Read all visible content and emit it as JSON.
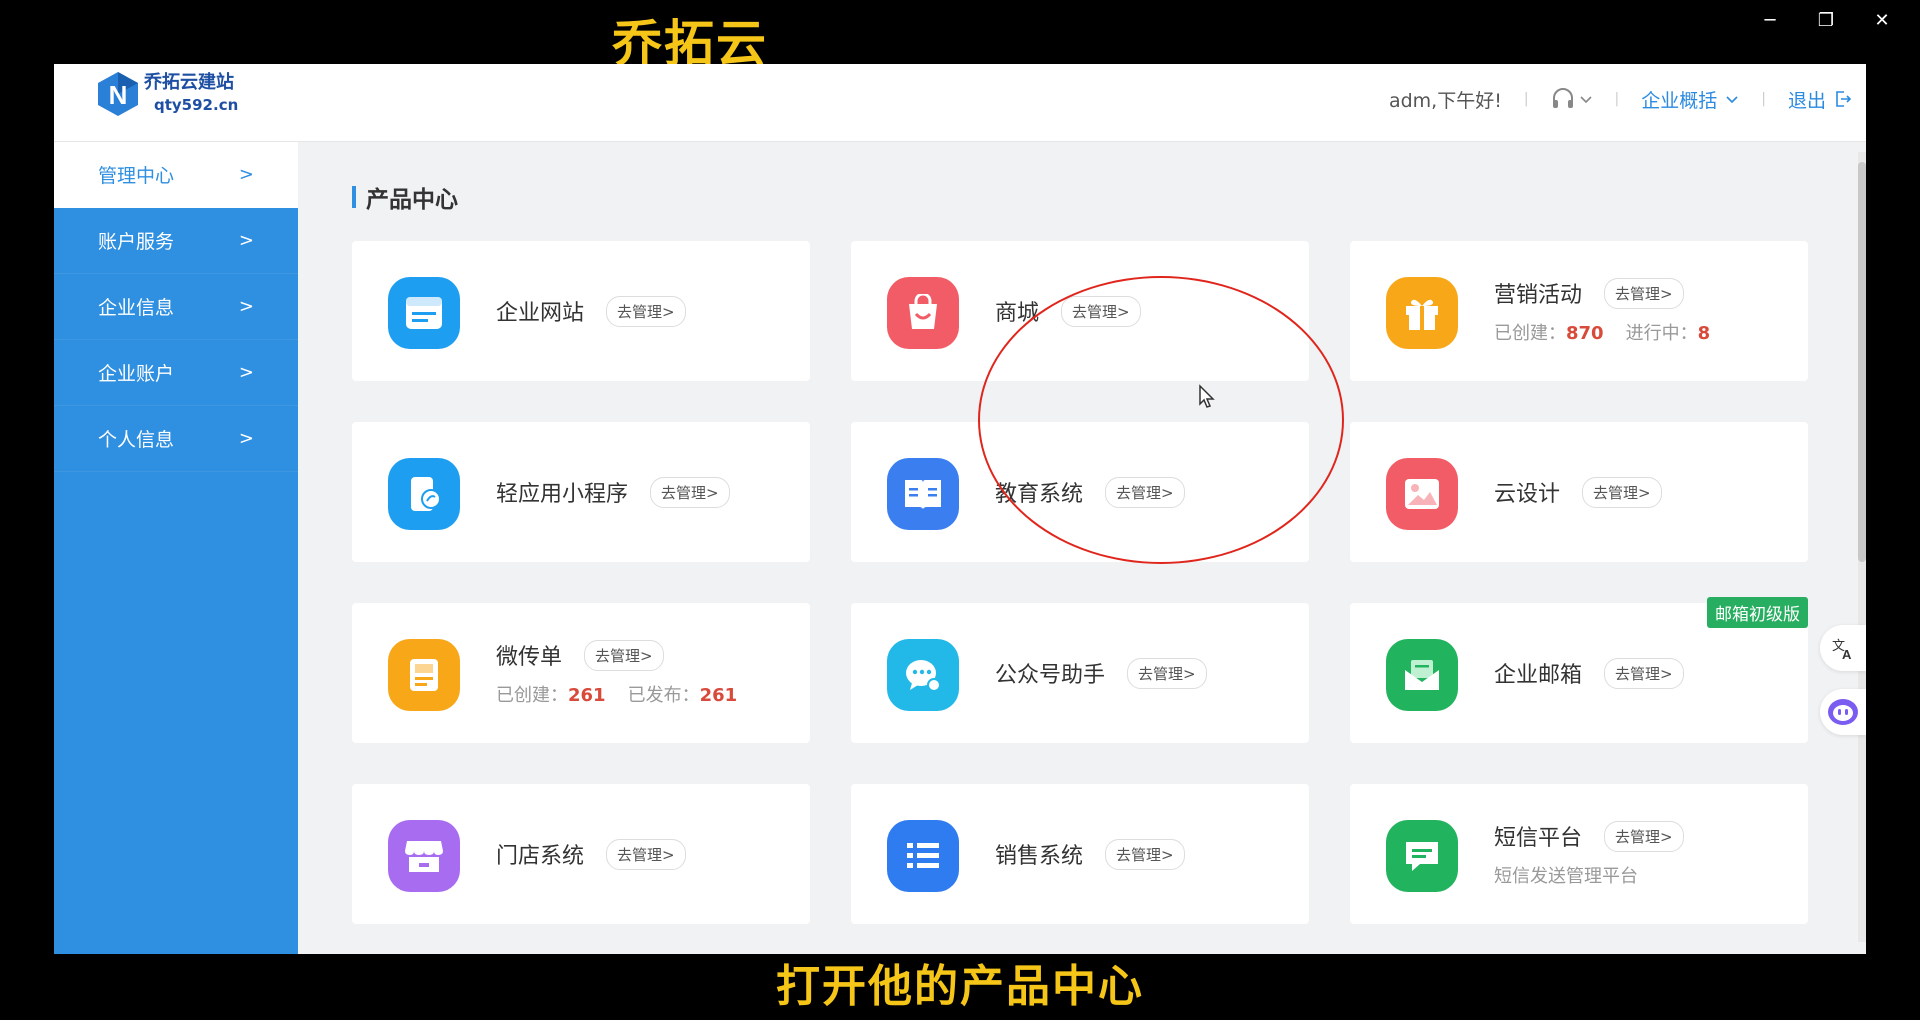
{
  "overlay": {
    "top_caption": "乔拓云",
    "bottom_caption": "打开他的产品中心"
  },
  "window_controls": {
    "minimize": "─",
    "restore": "❐",
    "close": "✕"
  },
  "header": {
    "logo_title": "乔拓云建站",
    "logo_sub": "qty592.cn",
    "greeting": "adm,下午好!",
    "overview": "企业概括",
    "logout": "退出"
  },
  "sidebar": {
    "items": [
      {
        "label": "管理中心"
      },
      {
        "label": "账户服务"
      },
      {
        "label": "企业信息"
      },
      {
        "label": "企业账户"
      },
      {
        "label": "个人信息"
      }
    ]
  },
  "main": {
    "title": "产品中心",
    "manage_label": "去管理>",
    "cards": [
      {
        "name": "企业网站",
        "icon": "browser-icon",
        "color": "#1e9ef0"
      },
      {
        "name": "商城",
        "icon": "shopping-bag-icon",
        "color": "#f25c66"
      },
      {
        "name": "营销活动",
        "icon": "gift-icon",
        "color": "#f8a718",
        "stat1_label": "已创建：",
        "stat1_value": "870",
        "stat2_label": "进行中：",
        "stat2_value": "8"
      },
      {
        "name": "轻应用小程序",
        "icon": "mini-app-icon",
        "color": "#1e9ef0"
      },
      {
        "name": "教育系统",
        "icon": "book-icon",
        "color": "#3a7ef0"
      },
      {
        "name": "云设计",
        "icon": "image-icon",
        "color": "#f25c66"
      },
      {
        "name": "微传单",
        "icon": "flyer-icon",
        "color": "#f8a718",
        "stat1_label": "已创建：",
        "stat1_value": "261",
        "stat2_label": "已发布：",
        "stat2_value": "261"
      },
      {
        "name": "公众号助手",
        "icon": "wechat-icon",
        "color": "#22b8e8"
      },
      {
        "name": "企业邮箱",
        "icon": "mail-icon",
        "color": "#22b35e",
        "badge": "邮箱初级版"
      },
      {
        "name": "门店系统",
        "icon": "store-icon",
        "color": "#a76cf0"
      },
      {
        "name": "销售系统",
        "icon": "list-icon",
        "color": "#2f7cf0"
      },
      {
        "name": "短信平台",
        "icon": "sms-icon",
        "color": "#22b35e",
        "desc": "短信发送管理平台"
      }
    ]
  },
  "float_buttons": {
    "translate": "translate-icon",
    "assistant": "robot-icon"
  }
}
